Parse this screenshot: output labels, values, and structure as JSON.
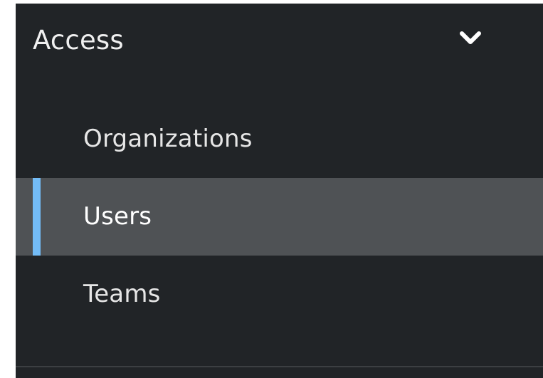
{
  "colors": {
    "panel_background": "#212427",
    "active_background": "#4f5255",
    "active_indicator": "#73bcf7",
    "text": "#f0f0f0"
  },
  "section": {
    "title": "Access",
    "expanded": true,
    "toggle_icon": "chevron-down-icon"
  },
  "items": [
    {
      "label": "Organizations",
      "active": false
    },
    {
      "label": "Users",
      "active": true
    },
    {
      "label": "Teams",
      "active": false
    }
  ]
}
